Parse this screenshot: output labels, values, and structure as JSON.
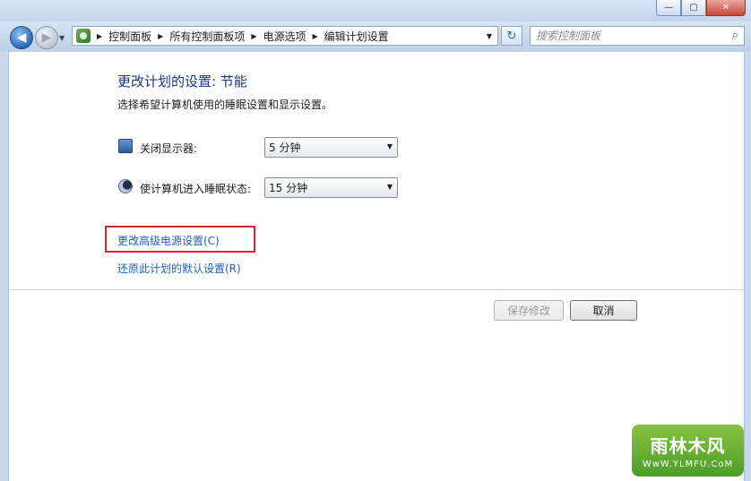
{
  "window": {
    "minimize_glyph": "—",
    "maximize_glyph": "▢",
    "close_glyph": "✕"
  },
  "nav": {
    "back_glyph": "◀",
    "forward_glyph": "▶",
    "recent_glyph": "▼",
    "breadcrumb": [
      "控制面板",
      "所有控制面板项",
      "电源选项",
      "编辑计划设置"
    ],
    "breadcrumb_sep": "▶",
    "address_drop_glyph": "▼",
    "refresh_glyph": "↻",
    "search_placeholder": "搜索控制面板",
    "search_icon": "search-icon"
  },
  "main": {
    "heading": "更改计划的设置: 节能",
    "description": "选择希望计算机使用的睡眠设置和显示设置。",
    "settings": [
      {
        "label": "关闭显示器:",
        "value": "5 分钟",
        "icon": "monitor-clock-icon"
      },
      {
        "label": "使计算机进入睡眠状态:",
        "value": "15 分钟",
        "icon": "moon-icon"
      }
    ],
    "dropdown_glyph": "▼",
    "links": {
      "advanced": "更改高级电源设置(C)",
      "restore": "还原此计划的默认设置(R)"
    },
    "highlight_color": "#d9262a",
    "buttons": {
      "save": "保存修改",
      "save_enabled": false,
      "cancel": "取消"
    }
  },
  "watermark": {
    "main": "雨林木风",
    "sub": "WwW.YLMFU.CoM"
  }
}
